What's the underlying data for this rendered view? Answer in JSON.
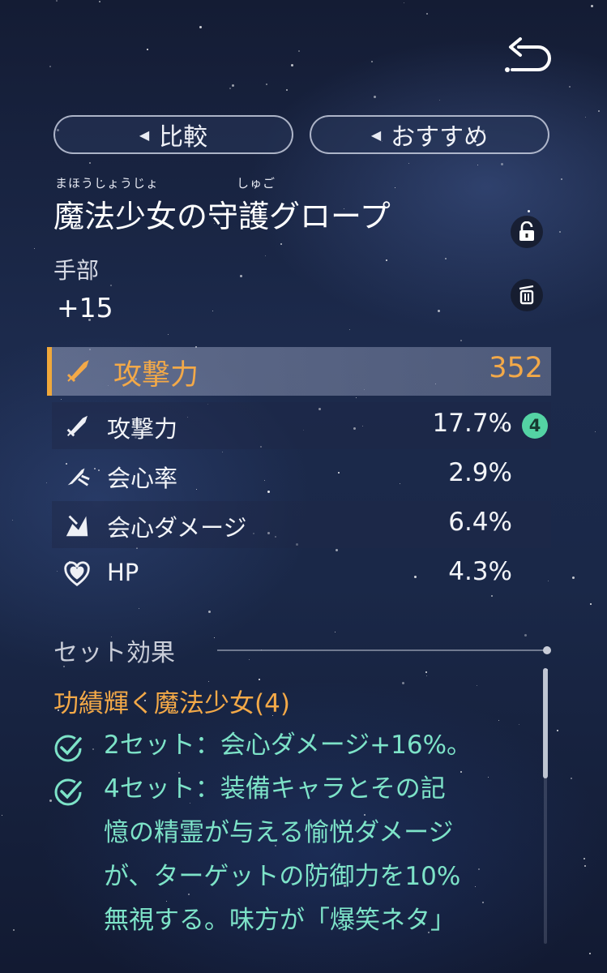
{
  "header": {
    "compare_label": "比較",
    "recommend_label": "おすすめ"
  },
  "item": {
    "furigana_1": "まほうしょうじょ",
    "furigana_2": "しゅご",
    "name": "魔法少女の守護グロープ",
    "slot": "手部",
    "level": "+15"
  },
  "main_stat": {
    "name": "攻撃力",
    "value": "352",
    "icon": "sword-icon"
  },
  "sub_stats": [
    {
      "name": "攻撃力",
      "value": "17.7%",
      "badge": "4",
      "icon": "sword-icon"
    },
    {
      "name": "会心率",
      "value": "2.9%",
      "icon": "crit-rate-icon"
    },
    {
      "name": "会心ダメージ",
      "value": "6.4%",
      "icon": "crit-damage-icon"
    },
    {
      "name": "HP",
      "value": "4.3%",
      "icon": "heart-icon"
    }
  ],
  "set_effect": {
    "section_title": "セット効果",
    "set_name": "功績輝く魔法少女(4)",
    "effects": [
      {
        "lines": [
          "2セット：会心ダメージ+16%。"
        ]
      },
      {
        "lines": [
          "4セット：装備キャラとその記",
          "憶の精霊が与える愉悦ダメージ",
          "が、ターゲットの防御力を10%",
          "無視する。味方が「爆笑ネタ」"
        ]
      }
    ]
  },
  "colors": {
    "accent_orange": "#f3a948",
    "teal": "#7de3c8",
    "badge": "#54d3a4"
  }
}
